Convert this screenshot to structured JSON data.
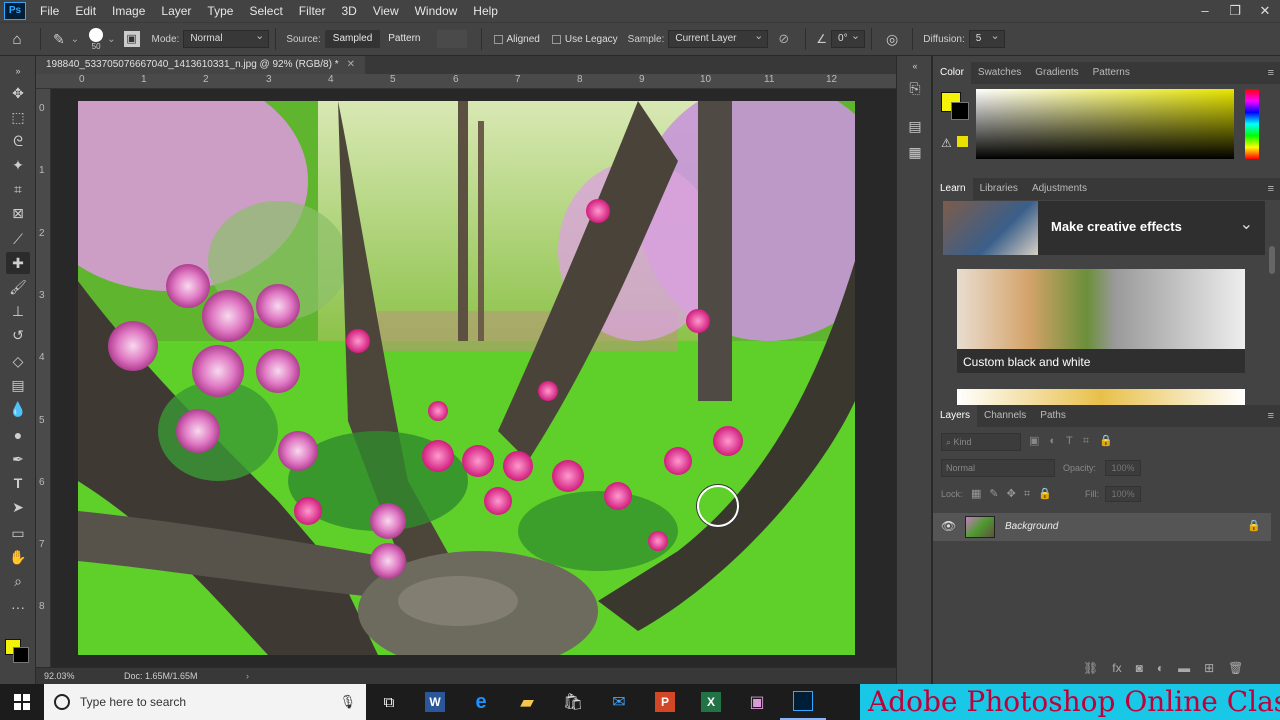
{
  "menubar": {
    "logo": "Ps",
    "items": [
      "File",
      "Edit",
      "Image",
      "Layer",
      "Type",
      "Select",
      "Filter",
      "3D",
      "View",
      "Window",
      "Help"
    ],
    "window_controls": [
      "–",
      "❐",
      "✕"
    ]
  },
  "options": {
    "brush_size": "50",
    "mode_label": "Mode:",
    "mode_value": "Normal",
    "source_label": "Source:",
    "source_sampled": "Sampled",
    "source_pattern": "Pattern",
    "aligned": "Aligned",
    "use_legacy": "Use Legacy",
    "sample_label": "Sample:",
    "sample_value": "Current Layer",
    "angle_value": "0°",
    "diffusion_label": "Diffusion:",
    "diffusion_value": "5"
  },
  "document": {
    "tab_title": "198840_533705076667040_1413610331_n.jpg @ 92% (RGB/8) *",
    "ruler_h": [
      "0",
      "1",
      "2",
      "3",
      "4",
      "5",
      "6",
      "7",
      "8",
      "9",
      "10",
      "11",
      "12"
    ],
    "ruler_v": [
      "0",
      "1",
      "2",
      "3",
      "4",
      "5",
      "6",
      "7",
      "8"
    ],
    "zoom": "92.03%",
    "doc_size": "Doc: 1.65M/1.65M"
  },
  "color_panel": {
    "tabs": [
      "Color",
      "Swatches",
      "Gradients",
      "Patterns"
    ],
    "foreground": "#f5f20a",
    "background": "#000000"
  },
  "learn_panel": {
    "tabs": [
      "Learn",
      "Libraries",
      "Adjustments"
    ],
    "heading": "Make creative effects",
    "card_title": "Custom black and white"
  },
  "layers_panel": {
    "tabs": [
      "Layers",
      "Channels",
      "Paths"
    ],
    "kind_placeholder": "Kind",
    "blend_mode": "Normal",
    "opacity_label": "Opacity:",
    "opacity_value": "100%",
    "lock_label": "Lock:",
    "fill_label": "Fill:",
    "fill_value": "100%",
    "layers": [
      {
        "name": "Background"
      }
    ]
  },
  "taskbar": {
    "search_placeholder": "Type here to search",
    "banner": "Adobe Photoshop Online Class"
  }
}
